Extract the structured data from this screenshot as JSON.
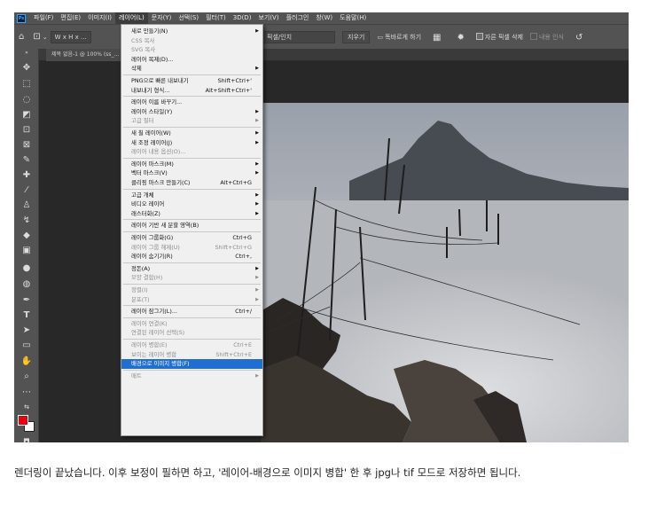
{
  "menubar": {
    "logo": "Ps",
    "items": [
      {
        "name": "menu-file",
        "label": "파일(F)"
      },
      {
        "name": "menu-edit",
        "label": "편집(E)"
      },
      {
        "name": "menu-image",
        "label": "이미지(I)"
      },
      {
        "name": "menu-layer",
        "label": "레이어(L)",
        "active": true
      },
      {
        "name": "menu-type",
        "label": "문자(Y)"
      },
      {
        "name": "menu-select",
        "label": "선택(S)"
      },
      {
        "name": "menu-filter",
        "label": "필터(T)"
      },
      {
        "name": "menu-3d",
        "label": "3D(D)"
      },
      {
        "name": "menu-view",
        "label": "보기(V)"
      },
      {
        "name": "menu-plugins",
        "label": "플러그인"
      },
      {
        "name": "menu-window",
        "label": "창(W)"
      },
      {
        "name": "menu-help",
        "label": "도움말(H)"
      }
    ]
  },
  "options_bar": {
    "ratio": "W x H x ...",
    "resolution_unit": "픽셀/인치",
    "clear_button": "지우기",
    "straighten_label": "똑바르게 하기",
    "delete_cropped_label": "자른 픽셀 삭제",
    "content_aware_label": "내용 인식"
  },
  "document": {
    "tab_label": "제목 없음-1 @ 100% (ss_..."
  },
  "layer_menu": {
    "items": [
      {
        "label": "새로 만들기(N)",
        "shortcut": "",
        "submenu": true,
        "disabled": false
      },
      {
        "label": "CSS 복사",
        "shortcut": "",
        "submenu": false,
        "disabled": true
      },
      {
        "label": "SVG 복사",
        "shortcut": "",
        "submenu": false,
        "disabled": true
      },
      {
        "label": "레이어 복제(D)...",
        "shortcut": "",
        "submenu": false,
        "disabled": false
      },
      {
        "label": "삭제",
        "shortcut": "",
        "submenu": true,
        "disabled": false
      },
      {
        "sep": true
      },
      {
        "label": "PNG으로 빠른 내보내기",
        "shortcut": "Shift+Ctrl+'",
        "submenu": false,
        "disabled": false
      },
      {
        "label": "내보내기 형식...",
        "shortcut": "Alt+Shift+Ctrl+'",
        "submenu": false,
        "disabled": false
      },
      {
        "sep": true
      },
      {
        "label": "레이어 이름 바꾸기...",
        "shortcut": "",
        "submenu": false,
        "disabled": false
      },
      {
        "label": "레이어 스타일(Y)",
        "shortcut": "",
        "submenu": true,
        "disabled": false
      },
      {
        "label": "고급 필터",
        "shortcut": "",
        "submenu": true,
        "disabled": true
      },
      {
        "sep": true
      },
      {
        "label": "새 칠 레이어(W)",
        "shortcut": "",
        "submenu": true,
        "disabled": false
      },
      {
        "label": "새 조정 레이어(J)",
        "shortcut": "",
        "submenu": true,
        "disabled": false
      },
      {
        "label": "레이어 내용 옵션(O)...",
        "shortcut": "",
        "submenu": false,
        "disabled": true
      },
      {
        "sep": true
      },
      {
        "label": "레이어 마스크(M)",
        "shortcut": "",
        "submenu": true,
        "disabled": false
      },
      {
        "label": "벡터 마스크(V)",
        "shortcut": "",
        "submenu": true,
        "disabled": false
      },
      {
        "label": "클리핑 마스크 만들기(C)",
        "shortcut": "Alt+Ctrl+G",
        "submenu": false,
        "disabled": false
      },
      {
        "sep": true
      },
      {
        "label": "고급 개체",
        "shortcut": "",
        "submenu": true,
        "disabled": false
      },
      {
        "label": "비디오 레이어",
        "shortcut": "",
        "submenu": true,
        "disabled": false
      },
      {
        "label": "래스터화(Z)",
        "shortcut": "",
        "submenu": true,
        "disabled": false
      },
      {
        "sep": true
      },
      {
        "label": "레이어 기반 새 분할 영역(B)",
        "shortcut": "",
        "submenu": false,
        "disabled": false
      },
      {
        "sep": true
      },
      {
        "label": "레이어 그룹화(G)",
        "shortcut": "Ctrl+G",
        "submenu": false,
        "disabled": false
      },
      {
        "label": "레이어 그룹 해제(U)",
        "shortcut": "Shift+Ctrl+G",
        "submenu": false,
        "disabled": true
      },
      {
        "label": "레이어 숨기기(R)",
        "shortcut": "Ctrl+,",
        "submenu": false,
        "disabled": false
      },
      {
        "sep": true
      },
      {
        "label": "정돈(A)",
        "shortcut": "",
        "submenu": true,
        "disabled": false
      },
      {
        "label": "모양 결합(H)",
        "shortcut": "",
        "submenu": true,
        "disabled": true
      },
      {
        "sep": true
      },
      {
        "label": "정렬(I)",
        "shortcut": "",
        "submenu": true,
        "disabled": true
      },
      {
        "label": "분포(T)",
        "shortcut": "",
        "submenu": true,
        "disabled": true
      },
      {
        "sep": true
      },
      {
        "label": "레이어 잠그기(L)...",
        "shortcut": "Ctrl+/",
        "submenu": false,
        "disabled": false
      },
      {
        "sep": true
      },
      {
        "label": "레이어 연결(K)",
        "shortcut": "",
        "submenu": false,
        "disabled": true
      },
      {
        "label": "연결된 레이어 선택(S)",
        "shortcut": "",
        "submenu": false,
        "disabled": true
      },
      {
        "sep": true
      },
      {
        "label": "레이어 병합(E)",
        "shortcut": "Ctrl+E",
        "submenu": false,
        "disabled": true
      },
      {
        "label": "보이는 레이어 병합",
        "shortcut": "Shift+Ctrl+E",
        "submenu": false,
        "disabled": true
      },
      {
        "label": "배경으로 이미지 병합(F)",
        "shortcut": "",
        "submenu": false,
        "disabled": false,
        "selected": true
      },
      {
        "sep": true
      },
      {
        "label": "매트",
        "shortcut": "",
        "submenu": true,
        "disabled": true
      }
    ]
  },
  "caption": "렌더링이 끝났습니다. 이후 보정이 필하면 하고, '레이어-배경으로 이미지 병합' 한 후 jpg나 tif 모드로 저장하면 됩니다."
}
